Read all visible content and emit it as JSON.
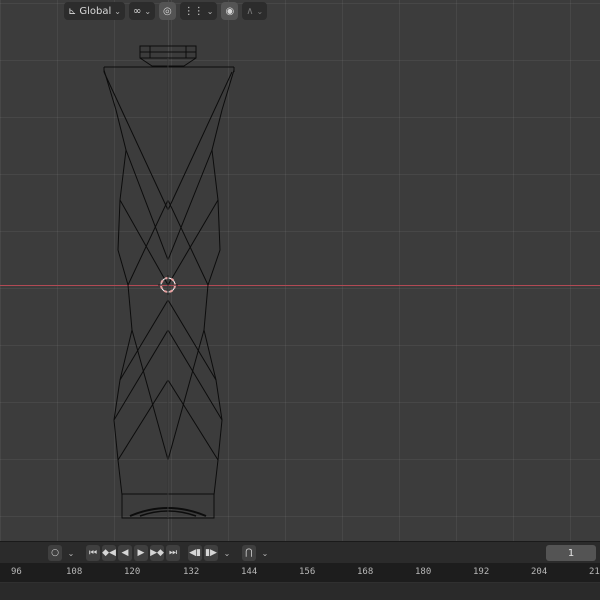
{
  "header": {
    "transform_orientation": "Global",
    "icons": [
      "axis-gizmo-icon",
      "pivot-link-icon",
      "snap-magnet-icon",
      "snap-increment-icon",
      "proportional-edit-icon",
      "falloff-icon"
    ]
  },
  "timeline": {
    "current_frame": "1",
    "ruler_ticks": [
      "96",
      "108",
      "120",
      "132",
      "144",
      "156",
      "168",
      "180",
      "192",
      "204",
      "21"
    ]
  },
  "colors": {
    "viewport_bg": "#3c3c3c",
    "x_axis": "#b24a55",
    "wire": "#0c0c0c",
    "ruler_bg": "#1d1d1d"
  }
}
